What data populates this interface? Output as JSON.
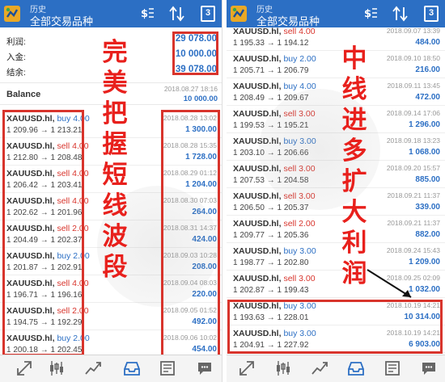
{
  "colors": {
    "appbar": "#2c6fc4",
    "buy": "#2c6fc4",
    "sell": "#d8342c",
    "highlight": "#d8342c",
    "annotation": "#e8201c"
  },
  "left": {
    "appbar": {
      "small_title": "历史",
      "main_title": "全部交易品种",
      "calendar_day": "3"
    },
    "summary": [
      {
        "label": "利润:",
        "value": "29 078.00"
      },
      {
        "label": "入金:",
        "value": "10 000.00"
      },
      {
        "label": "结余:",
        "value": "39 078.00"
      }
    ],
    "balance": {
      "label": "Balance",
      "date": "2018.08.27 18:16",
      "amount": "10 000.00"
    },
    "trades": [
      {
        "symbol": "XAUUSD.hl,",
        "side": "buy 4.00",
        "type": "buy",
        "prices": "1 209.96 → 1 213.21",
        "date": "2018.08.28 13:02",
        "profit": "1 300.00"
      },
      {
        "symbol": "XAUUSD.hl,",
        "side": "sell 4.00",
        "type": "sell",
        "prices": "1 212.80 → 1 208.48",
        "date": "2018.08.28 15:35",
        "profit": "1 728.00"
      },
      {
        "symbol": "XAUUSD.hl,",
        "side": "sell 4.00",
        "type": "sell",
        "prices": "1 206.42 → 1 203.41",
        "date": "2018.08.29 01:12",
        "profit": "1 204.00"
      },
      {
        "symbol": "XAUUSD.hl,",
        "side": "sell 4.00",
        "type": "sell",
        "prices": "1 202.62 → 1 201.96",
        "date": "2018.08.30 07:03",
        "profit": "264.00"
      },
      {
        "symbol": "XAUUSD.hl,",
        "side": "sell 2.00",
        "type": "sell",
        "prices": "1 204.49 → 1 202.37",
        "date": "2018.08.31 14:37",
        "profit": "424.00"
      },
      {
        "symbol": "XAUUSD.hl,",
        "side": "buy 2.00",
        "type": "buy",
        "prices": "1 201.87 → 1 202.91",
        "date": "2018.09.03 10:28",
        "profit": "208.00"
      },
      {
        "symbol": "XAUUSD.hl,",
        "side": "sell 4.00",
        "type": "sell",
        "prices": "1 196.71 → 1 196.16",
        "date": "2018.09.04 08:03",
        "profit": "220.00"
      },
      {
        "symbol": "XAUUSD.hl,",
        "side": "sell 2.00",
        "type": "sell",
        "prices": "1 194.75 → 1 192.29",
        "date": "2018.09.05 01:52",
        "profit": "492.00"
      },
      {
        "symbol": "XAUUSD.hl,",
        "side": "buy 2.00",
        "type": "buy",
        "prices": "1 200.18 → 1 202.45",
        "date": "2018.09.06 10:02",
        "profit": "454.00"
      }
    ],
    "annotation": [
      "完",
      "美",
      "把",
      "握",
      "短",
      "线",
      "波",
      "段"
    ]
  },
  "right": {
    "appbar": {
      "small_title": "历史",
      "main_title": "全部交易品种",
      "calendar_day": "3"
    },
    "trades": [
      {
        "symbol": "XAUUSD.hl,",
        "side": "sell 4.00",
        "type": "sell",
        "prices": "1 195.33 → 1 194.12",
        "date": "2018.09.07 13:39",
        "profit": "484.00"
      },
      {
        "symbol": "XAUUSD.hl,",
        "side": "buy 2.00",
        "type": "buy",
        "prices": "1 205.71 → 1 206.79",
        "date": "2018.09.10 18:50",
        "profit": "216.00"
      },
      {
        "symbol": "XAUUSD.hl,",
        "side": "buy 4.00",
        "type": "buy",
        "prices": "1 208.49 → 1 209.67",
        "date": "2018.09.11 13:45",
        "profit": "472.00"
      },
      {
        "symbol": "XAUUSD.hl,",
        "side": "sell 3.00",
        "type": "sell",
        "prices": "1 199.53 → 1 195.21",
        "date": "2018.09.14 17:06",
        "profit": "1 296.00"
      },
      {
        "symbol": "XAUUSD.hl,",
        "side": "buy 3.00",
        "type": "buy",
        "prices": "1 203.10 → 1 206.66",
        "date": "2018.09.18 13:23",
        "profit": "1 068.00"
      },
      {
        "symbol": "XAUUSD.hl,",
        "side": "sell 3.00",
        "type": "sell",
        "prices": "1 207.53 → 1 204.58",
        "date": "2018.09.20 15:57",
        "profit": "885.00"
      },
      {
        "symbol": "XAUUSD.hl,",
        "side": "sell 3.00",
        "type": "sell",
        "prices": "1 206.50 → 1 205.37",
        "date": "2018.09.21 11:37",
        "profit": "339.00"
      },
      {
        "symbol": "XAUUSD.hl,",
        "side": "sell 2.00",
        "type": "sell",
        "prices": "1 209.77 → 1 205.36",
        "date": "2018.09.21 11:37",
        "profit": "882.00"
      },
      {
        "symbol": "XAUUSD.hl,",
        "side": "buy 3.00",
        "type": "buy",
        "prices": "1 198.77 → 1 202.80",
        "date": "2018.09.24 15:43",
        "profit": "1 209.00"
      },
      {
        "symbol": "XAUUSD.hl,",
        "side": "sell 3.00",
        "type": "sell",
        "prices": "1 202.87 → 1 199.43",
        "date": "2018.09.25 02:09",
        "profit": "1 032.00"
      },
      {
        "symbol": "XAUUSD.hl,",
        "side": "buy 3.00",
        "type": "buy",
        "prices": "1 193.63 → 1 228.01",
        "date": "2018.10.19 14:21",
        "profit": "10 314.00"
      },
      {
        "symbol": "XAUUSD.hl,",
        "side": "buy 3.00",
        "type": "buy",
        "prices": "1 204.91 → 1 227.92",
        "date": "2018.10.19 14:21",
        "profit": "6 903.00"
      }
    ],
    "annotation": [
      "中",
      "线",
      "进",
      "多",
      "扩",
      "大",
      "利",
      "润"
    ]
  },
  "icons": {
    "appbar": [
      "app-logo-icon",
      "currency-icon",
      "sort-icon",
      "calendar-icon"
    ],
    "bottom_nav": [
      "arrows-icon",
      "candlestick-icon",
      "trend-line-icon",
      "inbox-icon",
      "news-icon",
      "chat-icon"
    ]
  }
}
